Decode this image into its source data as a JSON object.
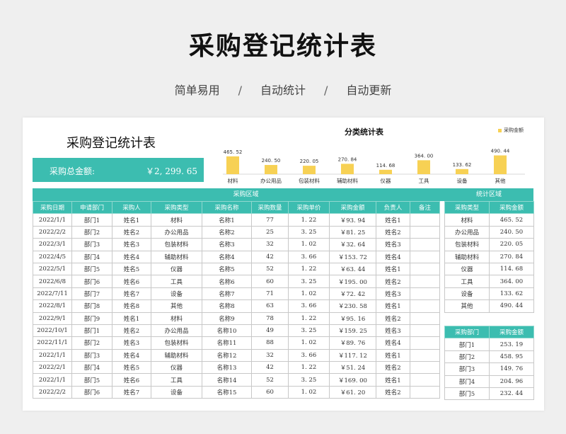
{
  "hero": {
    "title": "采购登记统计表",
    "taglines": [
      "简单易用",
      "自动统计",
      "自动更新"
    ],
    "separator": "/"
  },
  "sheet": {
    "title": "采购登记统计表",
    "total_label": "采购总金额:",
    "total_value": "￥2, 299. 65"
  },
  "colors": {
    "teal": "#3cbdb0",
    "bar": "#f7d154"
  },
  "chart_data": {
    "type": "bar",
    "title": "分类统计表",
    "legend": "采购金额",
    "legend_position": "top-right",
    "categories": [
      "材料",
      "办公用品",
      "包装材料",
      "辅助材料",
      "仪器",
      "工具",
      "设备",
      "其他"
    ],
    "values": [
      465.52,
      240.5,
      220.05,
      270.84,
      114.68,
      364.0,
      133.62,
      490.44
    ],
    "labels": [
      "465. 52",
      "240. 50",
      "220. 05",
      "270. 84",
      "114. 68",
      "364. 00",
      "133. 62",
      "490. 44"
    ],
    "ylim": [
      0,
      500
    ],
    "grid": false
  },
  "main_table": {
    "banner": "采购区域",
    "headers": [
      "采购日期",
      "申请部门",
      "采购人",
      "采购类型",
      "采购名称",
      "采购数量",
      "采购单价",
      "采购金额",
      "负责人",
      "备注"
    ],
    "rows": [
      [
        "2022/1/1",
        "部门1",
        "姓名1",
        "材料",
        "名称1",
        "77",
        "1. 22",
        "￥93. 94",
        "姓名1",
        ""
      ],
      [
        "2022/2/2",
        "部门2",
        "姓名2",
        "办公用品",
        "名称2",
        "25",
        "3. 25",
        "￥81. 25",
        "姓名2",
        ""
      ],
      [
        "2022/3/1",
        "部门3",
        "姓名3",
        "包装材料",
        "名称3",
        "32",
        "1. 02",
        "￥32. 64",
        "姓名3",
        ""
      ],
      [
        "2022/4/5",
        "部门4",
        "姓名4",
        "辅助材料",
        "名称4",
        "42",
        "3. 66",
        "￥153. 72",
        "姓名4",
        ""
      ],
      [
        "2022/5/1",
        "部门5",
        "姓名5",
        "仪器",
        "名称5",
        "52",
        "1. 22",
        "￥63. 44",
        "姓名1",
        ""
      ],
      [
        "2022/6/8",
        "部门6",
        "姓名6",
        "工具",
        "名称6",
        "60",
        "3. 25",
        "￥195. 00",
        "姓名2",
        ""
      ],
      [
        "2022/7/11",
        "部门7",
        "姓名7",
        "设备",
        "名称7",
        "71",
        "1. 02",
        "￥72. 42",
        "姓名3",
        ""
      ],
      [
        "2022/8/1",
        "部门8",
        "姓名8",
        "其他",
        "名称8",
        "63",
        "3. 66",
        "￥230. 58",
        "姓名1",
        ""
      ],
      [
        "2022/9/1",
        "部门9",
        "姓名1",
        "材料",
        "名称9",
        "78",
        "1. 22",
        "￥95. 16",
        "姓名2",
        ""
      ],
      [
        "2022/10/1",
        "部门1",
        "姓名2",
        "办公用品",
        "名称10",
        "49",
        "3. 25",
        "￥159. 25",
        "姓名3",
        ""
      ],
      [
        "2022/11/1",
        "部门2",
        "姓名3",
        "包装材料",
        "名称11",
        "88",
        "1. 02",
        "￥89. 76",
        "姓名4",
        ""
      ],
      [
        "2022/1/1",
        "部门3",
        "姓名4",
        "辅助材料",
        "名称12",
        "32",
        "3. 66",
        "￥117. 12",
        "姓名1",
        ""
      ],
      [
        "2022/2/1",
        "部门4",
        "姓名5",
        "仪器",
        "名称13",
        "42",
        "1. 22",
        "￥51. 24",
        "姓名2",
        ""
      ],
      [
        "2022/1/1",
        "部门5",
        "姓名6",
        "工具",
        "名称14",
        "52",
        "3. 25",
        "￥169. 00",
        "姓名1",
        ""
      ],
      [
        "2022/2/2",
        "部门6",
        "姓名7",
        "设备",
        "名称15",
        "60",
        "1. 02",
        "￥61. 20",
        "姓名2",
        ""
      ]
    ]
  },
  "stat_table": {
    "banner": "统计区域",
    "headers": [
      "采购类型",
      "采购金额"
    ],
    "rows": [
      [
        "材料",
        "465. 52"
      ],
      [
        "办公用品",
        "240. 50"
      ],
      [
        "包装材料",
        "220. 05"
      ],
      [
        "辅助材料",
        "270. 84"
      ],
      [
        "仪器",
        "114. 68"
      ],
      [
        "工具",
        "364. 00"
      ],
      [
        "设备",
        "133. 62"
      ],
      [
        "其他",
        "490. 44"
      ]
    ]
  },
  "dept_table": {
    "headers": [
      "采购部门",
      "采购金额"
    ],
    "rows": [
      [
        "部门1",
        "253. 19"
      ],
      [
        "部门2",
        "458. 95"
      ],
      [
        "部门3",
        "149. 76"
      ],
      [
        "部门4",
        "204. 96"
      ],
      [
        "部门5",
        "232. 44"
      ]
    ]
  }
}
